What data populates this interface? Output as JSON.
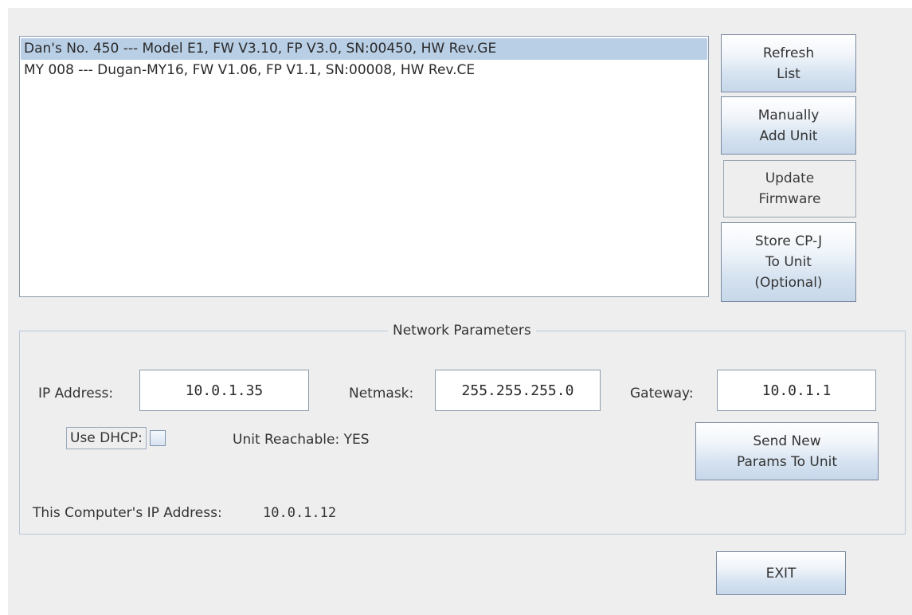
{
  "unit_list": {
    "items": [
      {
        "text": "Dan's No. 450 --- Model E1, FW V3.10, FP V3.0, SN:00450, HW Rev.GE",
        "selected": true
      },
      {
        "text": "MY 008 --- Dugan-MY16, FW V1.06, FP V1.1, SN:00008, HW Rev.CE",
        "selected": false
      }
    ]
  },
  "side_buttons": {
    "refresh_list": "Refresh\nList",
    "manually_add_unit": "Manually\nAdd Unit",
    "update_firmware": "Update\nFirmware",
    "store_cpj": "Store CP-J\nTo Unit\n(Optional)"
  },
  "network": {
    "title": "Network Parameters",
    "ip_label": "IP Address:",
    "ip_value": "10.0.1.35",
    "netmask_label": "Netmask:",
    "netmask_value": "255.255.255.0",
    "gateway_label": "Gateway:",
    "gateway_value": "10.0.1.1",
    "dhcp_label": "Use DHCP:",
    "dhcp_checked": false,
    "reachable_text": "Unit Reachable: YES",
    "send_button": "Send New\nParams To Unit",
    "computer_ip_label": "This Computer's IP Address:",
    "computer_ip_value": "10.0.1.12"
  },
  "exit_button": "EXIT",
  "colors": {
    "window_bg": "#eeeeee",
    "selection": "#b9cfe6",
    "button_border": "#7a8aa0"
  }
}
